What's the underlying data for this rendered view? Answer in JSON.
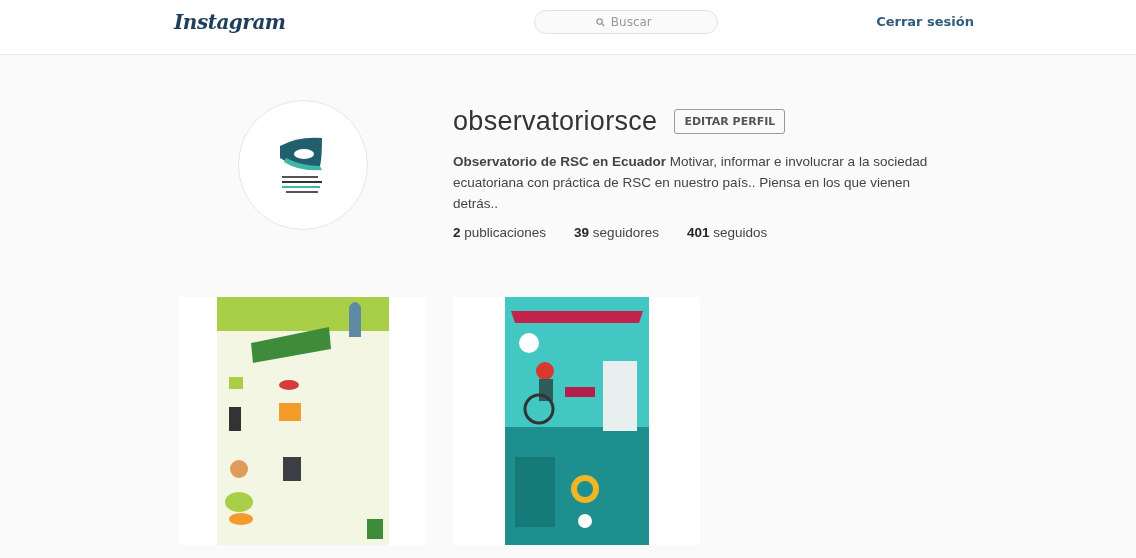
{
  "header": {
    "logo": "Instagram",
    "search": {
      "placeholder": "Buscar"
    },
    "logout": "Cerrar sesión"
  },
  "profile": {
    "username": "observatoriorsce",
    "edit_button": "EDITAR PERFIL",
    "bio": "**Observatorio de RSC en Ecuador** Motivar, informar e involucrar a la sociedad ecuatoriana con práctica de RSC en nuestro país.. Piensa en los que vienen detrás..",
    "stats": [
      {
        "count": "2",
        "label": "publicaciones"
      },
      {
        "count": "39",
        "label": "seguidores"
      },
      {
        "count": "401",
        "label": "seguidos"
      }
    ]
  }
}
